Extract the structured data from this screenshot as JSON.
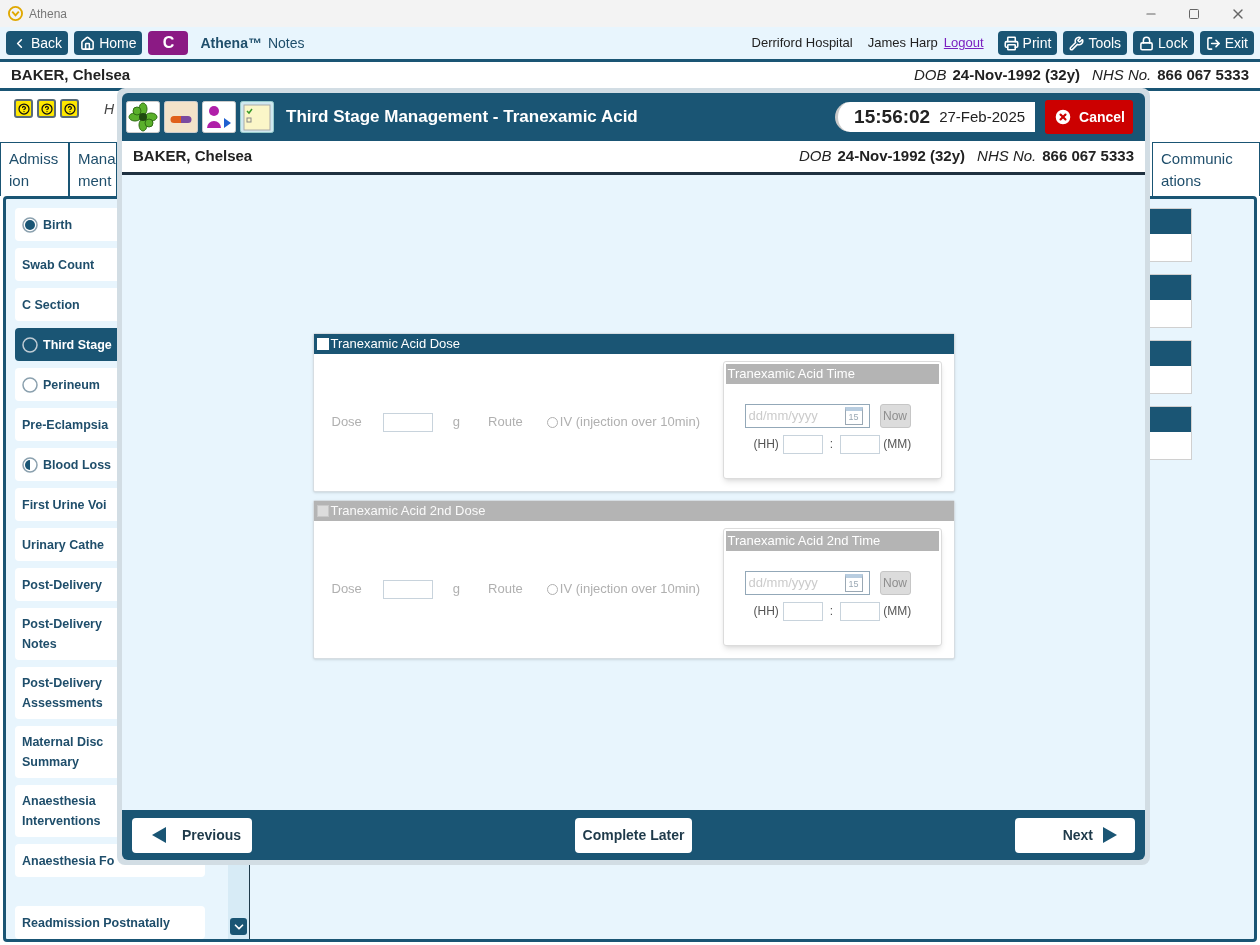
{
  "window": {
    "title": "Athena"
  },
  "toolbar": {
    "nav_buttons": [
      {
        "label": "Back"
      },
      {
        "label": "Home"
      }
    ],
    "patient_badge": "C",
    "app_name": "Athena™",
    "app_suffix": "Notes",
    "hospital": "Derriford Hospital",
    "user": "James Harp",
    "logout": "Logout",
    "actions": [
      {
        "label": "Print"
      },
      {
        "label": "Tools"
      },
      {
        "label": "Lock"
      },
      {
        "label": "Exit"
      }
    ]
  },
  "patient_banner": {
    "name": "BAKER, Chelsea",
    "dob_label": "DOB",
    "dob": "24-Nov-1992 (32y)",
    "nhs_label": "NHS No.",
    "nhs": "866 067 5333"
  },
  "info_text": "H",
  "tabs": [
    {
      "label": "Admission"
    },
    {
      "label": "Mana ment"
    },
    {
      "label": "Communications"
    }
  ],
  "sidebar": {
    "items": [
      {
        "label": "Birth",
        "kind": "complete",
        "selected": false
      },
      {
        "label": "Swab Count",
        "kind": "plain",
        "selected": false
      },
      {
        "label": "C Section",
        "kind": "plain",
        "selected": false
      },
      {
        "label": "Third Stage",
        "kind": "empty",
        "selected": true
      },
      {
        "label": "Perineum",
        "kind": "empty",
        "selected": false
      },
      {
        "label": "Pre-Eclampsia",
        "kind": "plain",
        "selected": false
      },
      {
        "label": "Blood Loss",
        "kind": "partial",
        "selected": false
      },
      {
        "label": "First Urine Voi",
        "kind": "plain",
        "selected": false
      },
      {
        "label": "Urinary Cathe",
        "kind": "plain",
        "selected": false
      },
      {
        "label": "Post-Delivery",
        "kind": "plain",
        "selected": false
      },
      {
        "label": "Post-Delivery\nNotes",
        "kind": "plain",
        "selected": false
      },
      {
        "label": "Post-Delivery\nAssessments",
        "kind": "plain",
        "selected": false
      },
      {
        "label": "Maternal Disc\nSummary",
        "kind": "plain",
        "selected": false
      },
      {
        "label": "Anaesthesia\nInterventions",
        "kind": "plain",
        "selected": false
      },
      {
        "label": "Anaesthesia Fo",
        "kind": "plain",
        "selected": false
      },
      {
        "label": "Readmission Postnatally",
        "kind": "plain",
        "selected": false
      }
    ]
  },
  "modal": {
    "title": "Third Stage Management - Tranexamic Acid",
    "time": "15:56:02",
    "date": "27-Feb-2025",
    "cancel": "Cancel",
    "patient": {
      "name": "BAKER, Chelsea",
      "dob_label": "DOB",
      "dob": "24-Nov-1992 (32y)",
      "nhs_label": "NHS No.",
      "nhs": "866 067 5333"
    },
    "sections": [
      {
        "title": "Tranexamic Acid Dose",
        "checked": false,
        "disabled": false,
        "dose_label": "Dose",
        "unit": "g",
        "route_label": "Route",
        "route_option": {
          "label": "IV (injection over 10min)",
          "selected": false
        },
        "time_panel": {
          "title": "Tranexamic Acid Time",
          "date_placeholder": "dd/mm/yyyy",
          "calendar_day": "15",
          "now": "Now",
          "hh": "(HH)",
          "separator": ":",
          "mm": "(MM)"
        }
      },
      {
        "title": "Tranexamic Acid 2nd Dose",
        "checked": false,
        "disabled": true,
        "dose_label": "Dose",
        "unit": "g",
        "route_label": "Route",
        "route_option": {
          "label": "IV (injection over 10min)",
          "selected": false
        },
        "time_panel": {
          "title": "Tranexamic Acid 2nd Time",
          "date_placeholder": "dd/mm/yyyy",
          "calendar_day": "15",
          "now": "Now",
          "hh": "(HH)",
          "separator": ":",
          "mm": "(MM)"
        }
      }
    ],
    "footer": {
      "previous": "Previous",
      "complete_later": "Complete Later",
      "next": "Next"
    }
  }
}
